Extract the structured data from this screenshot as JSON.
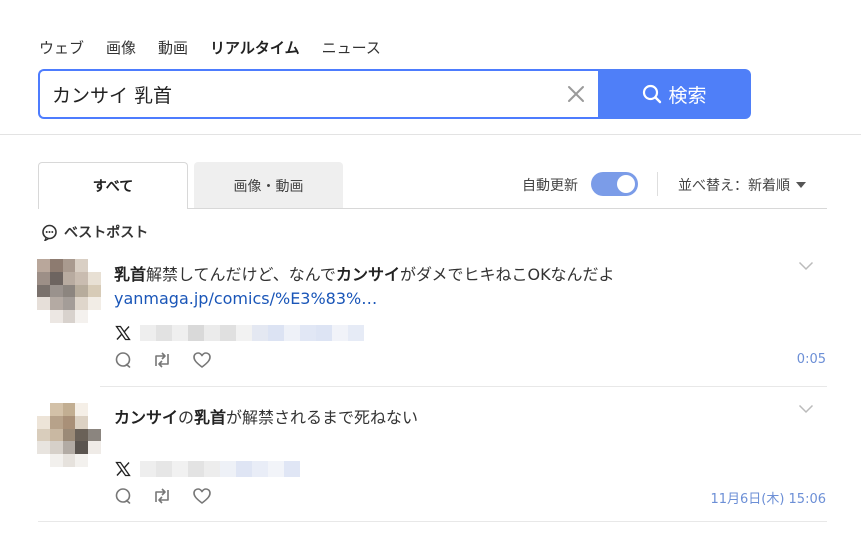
{
  "nav": {
    "items": [
      "ウェブ",
      "画像",
      "動画",
      "リアルタイム",
      "ニュース"
    ],
    "active_index": 3
  },
  "search": {
    "query": "カンサイ 乳首",
    "button_label": "検索"
  },
  "tabs": {
    "all": "すべて",
    "images_videos": "画像・動画"
  },
  "controls": {
    "auto_update_label": "自動更新",
    "auto_update_on": true,
    "sort_label": "並べ替え：新着順"
  },
  "best_posts_label": "ベストポスト",
  "posts": [
    {
      "text_parts": [
        {
          "t": "乳首",
          "b": true
        },
        {
          "t": "解禁してんだけど、なんで",
          "b": false
        },
        {
          "t": "カンサイ",
          "b": true
        },
        {
          "t": "がダメでヒキねこOKなんだよ",
          "b": false
        }
      ],
      "link": "yanmaga.jp/comics/%E3%83%…",
      "time": "0:05"
    },
    {
      "text_parts": [
        {
          "t": "カンサイ",
          "b": true
        },
        {
          "t": "の",
          "b": false
        },
        {
          "t": "乳首",
          "b": true
        },
        {
          "t": "が解禁されるまで死ねない",
          "b": false
        }
      ],
      "link": "",
      "time": "11月6日(木) 15:06"
    }
  ],
  "colors": {
    "accent": "#4f7ff8",
    "link": "#1a56b8",
    "time": "#6c8fd6",
    "toggle": "#7b9ce8"
  }
}
